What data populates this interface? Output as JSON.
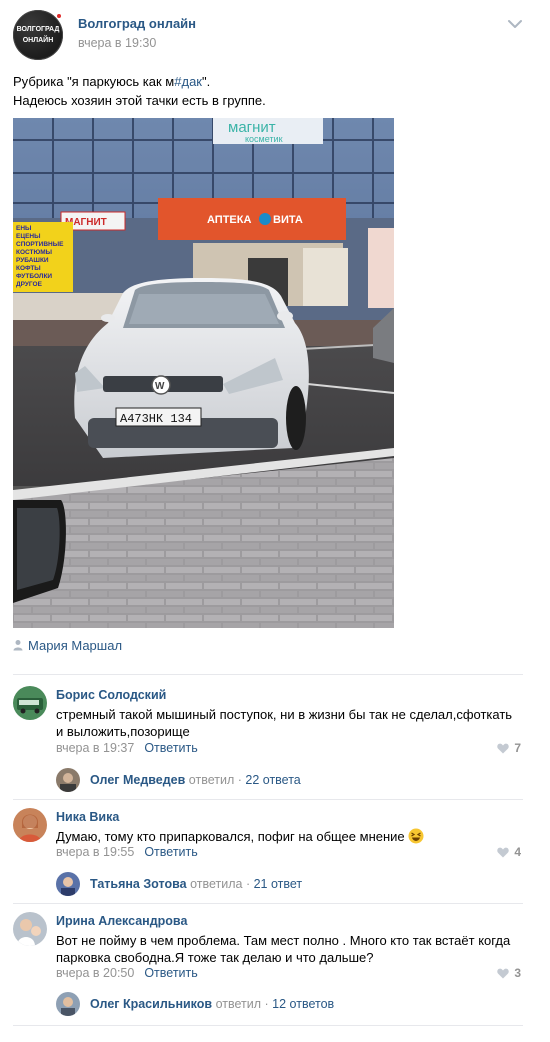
{
  "post": {
    "group_name": "Волгоград онлайн",
    "avatar_line1": "ВОЛГОГРАД",
    "avatar_line2": "ОНЛАЙН",
    "time": "вчера в 19:30",
    "text_line1_prefix": "Рубрика \"я паркуюсь как м",
    "text_hashtag": "#дак",
    "text_line1_suffix": "\".",
    "text_line2": "Надеюсь хозяин этой тачки есть в группе.",
    "author": "Мария Маршал",
    "photo": {
      "sign_magnit_top": "магнит",
      "sign_kosmetik": "косметик",
      "sign_apteka": "АПТЕКА",
      "sign_vita": "ВИТА",
      "sign_magnit_small": "МАГНИТ",
      "poster_lines": [
        "ЕНЫ",
        "ЕЦЕНЫ",
        "СПОРТИВНЫЕ",
        "КОСТЮМЫ",
        "РУБАШКИ",
        "КОФТЫ",
        "ФУТБОЛКИ",
        "ДРУГОЕ"
      ],
      "plate": "А473НК 134"
    }
  },
  "comments": [
    {
      "name": "Борис Солодский",
      "text": "стремный такой мышиный поступок, ни в жизни бы так не сделал,сфоткать и выложить,позорище",
      "time": "вчера в 19:37",
      "reply_label": "Ответить",
      "likes": "7",
      "thread_name": "Олег Медведев",
      "thread_verb": "ответил",
      "thread_sep": "·",
      "thread_count": "22 ответа"
    },
    {
      "name": "Ника Вика",
      "text": "Думаю, тому кто припарковался, пофиг на общее мнение",
      "time": "вчера в 19:55",
      "reply_label": "Ответить",
      "likes": "4",
      "thread_name": "Татьяна Зотова",
      "thread_verb": "ответила",
      "thread_sep": "·",
      "thread_count": "21 ответ"
    },
    {
      "name": "Ирина Александрова",
      "text": "Вот не пойму в чем проблема. Там мест полно . Много кто так встаёт когда парковка свободна.Я тоже так делаю и что дальше?",
      "time": "вчера в 20:50",
      "reply_label": "Ответить",
      "likes": "3",
      "thread_name": "Олег Красильников",
      "thread_verb": "ответил",
      "thread_sep": "·",
      "thread_count": "12 ответов"
    }
  ]
}
